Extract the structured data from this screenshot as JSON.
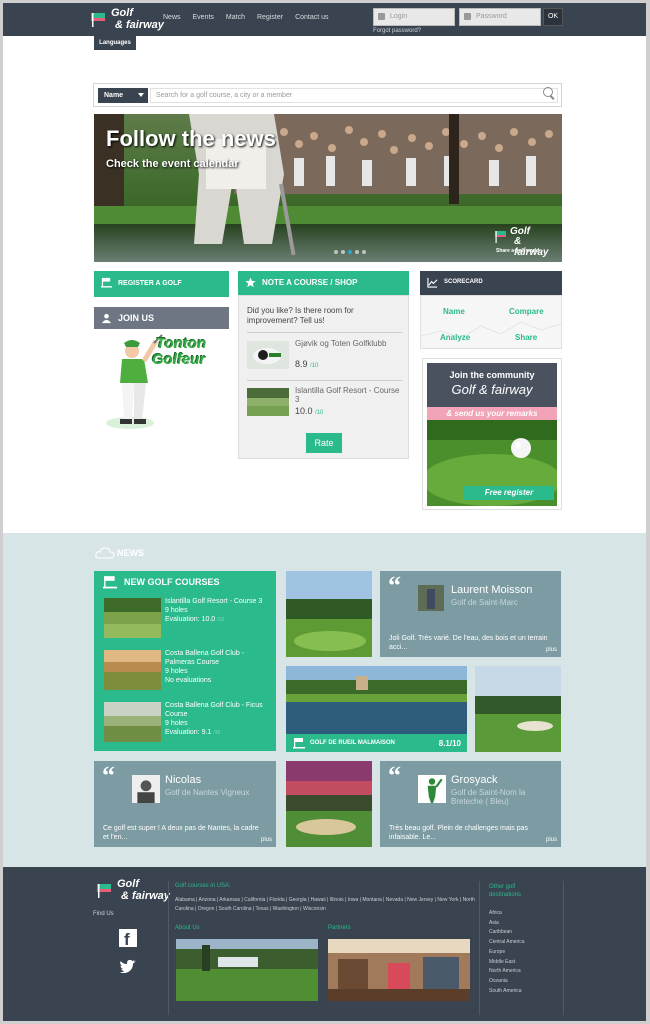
{
  "header": {
    "logo_line1": "Golf",
    "logo_line2": "& fairway",
    "nav": [
      "News",
      "Events",
      "Match",
      "Register",
      "Contact us"
    ],
    "login_placeholder": "Login",
    "password_placeholder": "Password",
    "ok_label": "OK",
    "forgot": "Forgot password?",
    "languages": "Languages"
  },
  "search": {
    "select_value": "Name",
    "placeholder": "Search for a golf course, a city or a member"
  },
  "hero": {
    "title": "Follow the news",
    "subtitle": "Check the event calendar",
    "logo_line1": "Golf",
    "logo_line2": "& fairway",
    "tagline": "Share a golf world"
  },
  "left": {
    "register": "REGISTER A GOLF",
    "join": "JOIN US",
    "mascot_line1": "Tonton",
    "mascot_line2": "Golfeur"
  },
  "note": {
    "title": "NOTE A COURSE / SHOP",
    "question": "Did you like? Is there room for improvement? Tell us!",
    "items": [
      {
        "name": "Gjøvik og Toten Golfklubb",
        "score": "8.9",
        "out_of": "/10"
      },
      {
        "name": "Islantilla Golf Resort - Course 3",
        "score": "10.0",
        "out_of": "/10"
      }
    ],
    "rate": "Rate"
  },
  "scorecard": {
    "title": "SCORECARD",
    "links": [
      "Name",
      "Compare",
      "Analyze",
      "Share"
    ]
  },
  "community": {
    "line1": "Join the community",
    "line2": "Golf & fairway",
    "remarks": "& send us your remarks",
    "free": "Free register"
  },
  "news": {
    "title": "NEWS",
    "new_courses_title": "NEW GOLF COURSES",
    "new_courses": [
      {
        "name": "Islantilla Golf Resort - Course 3",
        "holes": "9 holes",
        "eval": "Evaluation: 10.0",
        "suffix": "/10"
      },
      {
        "name": "Costa Ballena Golf Club - Palmeras Course",
        "holes": "9 holes",
        "eval": "No evaluations",
        "suffix": ""
      },
      {
        "name": "Costa Ballena Golf Club - Ficus Course",
        "holes": "9 holes",
        "eval": "Evaluation: 9.1",
        "suffix": "/10"
      }
    ],
    "featured_name": "GOLF DE RUEIL MALMAISON",
    "featured_score": "8.1/10",
    "reviews": [
      {
        "name": "Laurent Moisson",
        "course": "Golf de Saint-Marc",
        "comment": "Joli Golf. Très varié. De l'eau, des bois et un terrain acci...",
        "more": "plus"
      },
      {
        "name": "Nicolas",
        "course": "Golf de Nantes Vigneux",
        "comment": "Ce golf est super ! A deux pas de Nantes, la cadre et l'en...",
        "more": "plus"
      },
      {
        "name": "Grosyack",
        "course": "Golf de Saint-Nom la Breteche ( Bleu)",
        "comment": "Très beau golf. Plein de challenges mais pas infaisable. Le...",
        "more": "plus"
      }
    ]
  },
  "footer": {
    "logo_line1": "Golf",
    "logo_line2": "& fairway",
    "find_us": "Find Us",
    "courses_title": "Golf courses in USA:",
    "states": "Alabama | Arizona | Arkansas | California | Florida | Georgia | Hawaii | Illinois | Iowa | Montana | Nevada | New Jersey | New York | North Carolina | Oregon | South Carolina | Texas | Washington | Wisconsin",
    "about": "About Us",
    "partners": "Partners",
    "other_title": "Other golf destinations",
    "destinations": [
      "Africa",
      "Asia",
      "Caribbean",
      "Central America",
      "Europe",
      "Middle East",
      "North America",
      "Oceania",
      "South America"
    ]
  },
  "colors": {
    "header_bg": "#3a4350",
    "accent_green": "#2bba8c",
    "news_bg": "#d8e5e7",
    "review_tile": "#7d9ba3"
  }
}
